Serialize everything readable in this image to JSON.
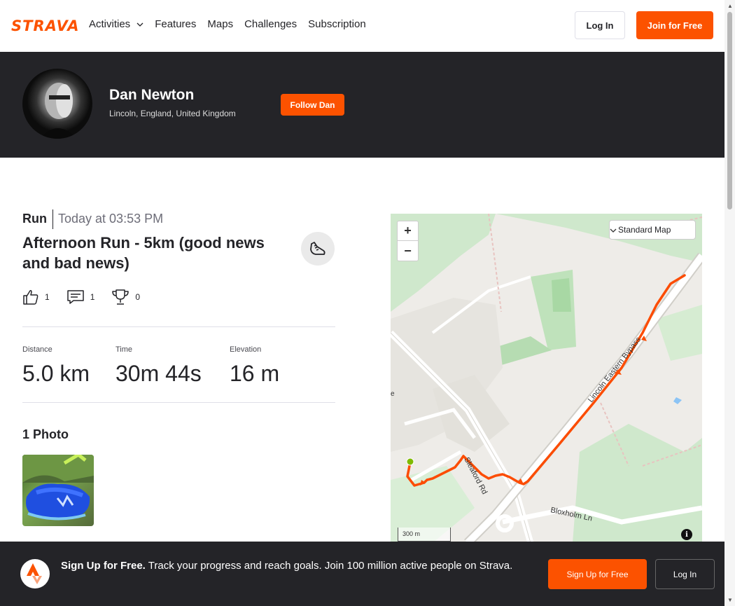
{
  "nav": {
    "logo": "STRAVA",
    "links": [
      "Activities",
      "Features",
      "Maps",
      "Challenges",
      "Subscription"
    ],
    "login_label": "Log In",
    "join_label": "Join for Free"
  },
  "athlete": {
    "name": "Dan Newton",
    "location": "Lincoln, England, United Kingdom",
    "follow_label": "Follow Dan"
  },
  "activity": {
    "type": "Run",
    "time": "Today at 03:53 PM",
    "title": "Afternoon Run - 5km (good news and bad news)",
    "kudos": "1",
    "comments": "1",
    "achievements": "0",
    "stats": [
      {
        "label": "Distance",
        "value": "5.0 km"
      },
      {
        "label": "Time",
        "value": "30m 44s"
      },
      {
        "label": "Elevation",
        "value": "16 m"
      }
    ],
    "photos_heading": "1 Photo"
  },
  "map": {
    "type_label": "Standard Map",
    "zoom_in": "+",
    "zoom_out": "−",
    "scale_label": "300 m",
    "labels": {
      "bypass": "Lincoln Eastern Bypass",
      "sleaford": "Sleaford Rd",
      "bloxholm": "Bloxholm Ln",
      "edge": "e"
    },
    "route_color": "#fc4c02",
    "start_color": "#7fba00"
  },
  "banner": {
    "headline": "Sign Up for Free.",
    "text": "Track your progress and reach goals. Join 100 million active people on Strava.",
    "signup_label": "Sign Up for Free",
    "login_label": "Log In"
  },
  "colors": {
    "brand": "#fc5200",
    "dark": "#242428"
  }
}
